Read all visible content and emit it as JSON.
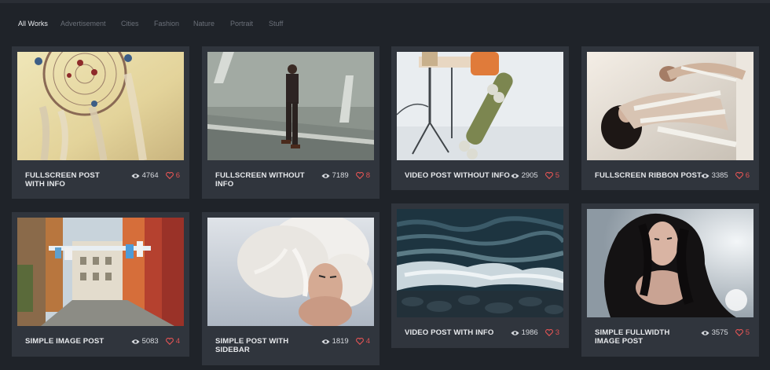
{
  "filters": [
    {
      "label": "All Works",
      "active": true
    },
    {
      "label": "Advertisement"
    },
    {
      "label": "Cities"
    },
    {
      "label": "Fashion"
    },
    {
      "label": "Nature"
    },
    {
      "label": "Portrait"
    },
    {
      "label": "Stuff"
    }
  ],
  "posts": [
    {
      "title": "FULLSCREEN POST WITH INFO",
      "views": "4764",
      "likes": "6",
      "image": "dreamcatcher"
    },
    {
      "title": "FULLSCREEN WITHOUT INFO",
      "views": "7189",
      "likes": "8",
      "image": "man-walking-road"
    },
    {
      "title": "VIDEO POST WITHOUT INFO",
      "views": "2905",
      "likes": "5",
      "image": "skateboard-studio"
    },
    {
      "title": "FULLSCREEN RIBBON POST",
      "views": "3385",
      "likes": "6",
      "image": "ribbon-fashion"
    },
    {
      "title": "SIMPLE IMAGE POST",
      "views": "5083",
      "likes": "4",
      "image": "city-alley"
    },
    {
      "title": "SIMPLE POST WITH SIDEBAR",
      "views": "1819",
      "likes": "4",
      "image": "blonde-portrait"
    },
    {
      "title": "VIDEO POST WITH INFO",
      "views": "1986",
      "likes": "3",
      "image": "ocean-waves"
    },
    {
      "title": "SIMPLE FULLWIDTH IMAGE POST",
      "views": "3575",
      "likes": "5",
      "image": "dark-hair-portrait"
    }
  ],
  "colors": {
    "background": "#1f2329",
    "card": "#30353d",
    "like": "#e25454"
  }
}
